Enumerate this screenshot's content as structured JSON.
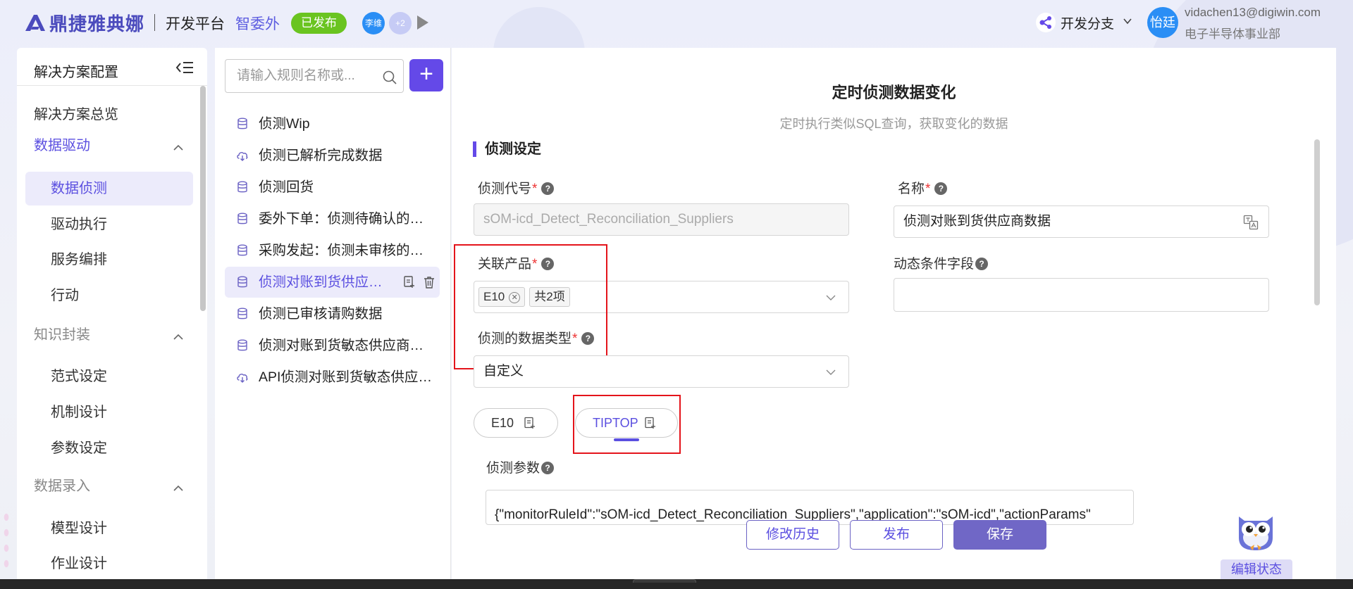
{
  "header": {
    "brand": "鼎捷雅典娜",
    "platform": "开发平台",
    "project": "智委外",
    "status": "已发布",
    "collaborators": [
      "李维",
      "+2"
    ],
    "branch_label": "开发分支",
    "user": {
      "avatar": "怡廷",
      "email": "vidachen13@digiwin.com",
      "department": "电子半导体事业部"
    }
  },
  "sidebar": {
    "title": "解决方案配置",
    "items": [
      {
        "label": "解决方案总览"
      },
      {
        "label": "数据驱动",
        "group": true,
        "open": true
      },
      {
        "label": "数据侦测",
        "active": true
      },
      {
        "label": "驱动执行"
      },
      {
        "label": "服务编排"
      },
      {
        "label": "行动"
      },
      {
        "label": "知识封装",
        "group": true
      },
      {
        "label": "范式设定"
      },
      {
        "label": "机制设计"
      },
      {
        "label": "参数设定"
      },
      {
        "label": "数据录入",
        "group": true
      },
      {
        "label": "模型设计"
      },
      {
        "label": "作业设计"
      }
    ]
  },
  "rules": {
    "search_placeholder": "请输入规则名称或...",
    "items": [
      {
        "label": "侦测Wip",
        "icon": "database-icon"
      },
      {
        "label": "侦测已解析完成数据",
        "icon": "cloud-download-icon"
      },
      {
        "label": "侦测回货",
        "icon": "database-icon"
      },
      {
        "label": "委外下单：侦测待确认的委外单",
        "icon": "database-icon"
      },
      {
        "label": "采购发起：侦测未审核的请购单",
        "icon": "database-icon"
      },
      {
        "label": "侦测对账到货供应商数据",
        "icon": "database-icon",
        "active": true
      },
      {
        "label": "侦测已审核请购数据",
        "icon": "database-icon"
      },
      {
        "label": "侦测对账到货敏态供应商数据",
        "icon": "database-icon"
      },
      {
        "label": "API侦测对账到货敏态供应商数据",
        "icon": "cloud-download-icon"
      }
    ]
  },
  "main": {
    "title": "定时侦测数据变化",
    "subtitle": "定时执行类似SQL查询，获取变化的数据",
    "section": "侦测设定",
    "code_label": "侦测代号",
    "code_value": "sOM-icd_Detect_Reconciliation_Suppliers",
    "name_label": "名称",
    "name_value": "侦测对账到货供应商数据",
    "product_label": "关联产品",
    "product_tag": "E10",
    "product_count": "共2项",
    "dynamic_label": "动态条件字段",
    "dynamic_value": "",
    "datatype_label": "侦测的数据类型",
    "datatype_value": "自定义",
    "product_tabs": [
      "E10",
      "TIPTOP"
    ],
    "active_tab": "TIPTOP",
    "param_label": "侦测参数",
    "param_value": "{\"monitorRuleId\":\"sOM-icd_Detect_Reconciliation_Suppliers\",\"application\":\"sOM-icd\",\"actionParams\""
  },
  "actions": {
    "history": "修改历史",
    "publish": "发布",
    "save": "保存"
  },
  "edit_state": "编辑状态",
  "colors": {
    "accent": "#6449e8",
    "published": "#6ac420",
    "annotation": "#e4141b"
  }
}
